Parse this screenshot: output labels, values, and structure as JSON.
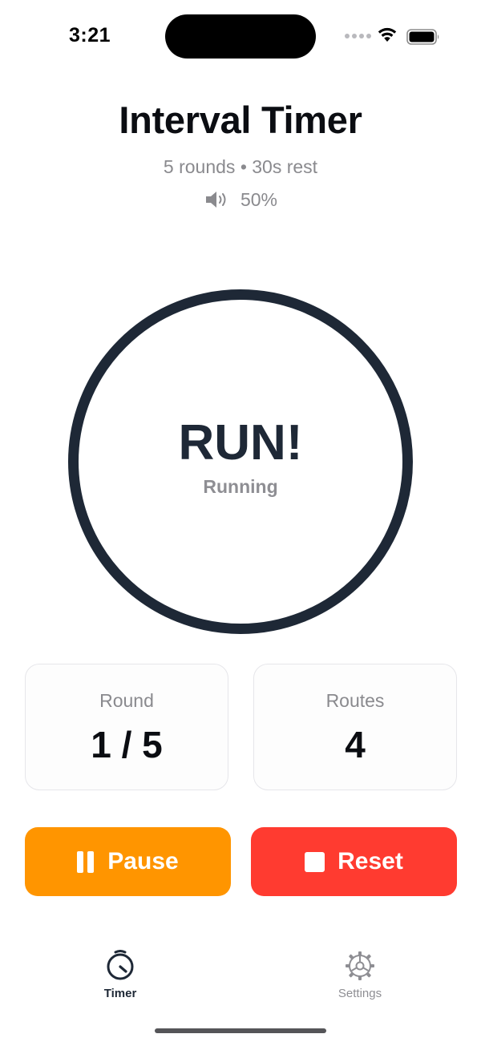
{
  "status_bar": {
    "time": "3:21"
  },
  "header": {
    "title": "Interval Timer",
    "subtitle": "5 rounds • 30s rest",
    "volume_level": "50%"
  },
  "ring": {
    "phase": "RUN!",
    "state": "Running",
    "color": "#1e2836"
  },
  "stats": {
    "round": {
      "label": "Round",
      "value": "1 / 5"
    },
    "routes": {
      "label": "Routes",
      "value": "4"
    }
  },
  "controls": {
    "pause_label": "Pause",
    "pause_color": "#ff9500",
    "reset_label": "Reset",
    "reset_color": "#ff3b30"
  },
  "tab_bar": {
    "tabs": [
      {
        "label": "Timer",
        "icon": "stopwatch-icon",
        "active": true
      },
      {
        "label": "Settings",
        "icon": "gear-icon",
        "active": false
      }
    ]
  }
}
